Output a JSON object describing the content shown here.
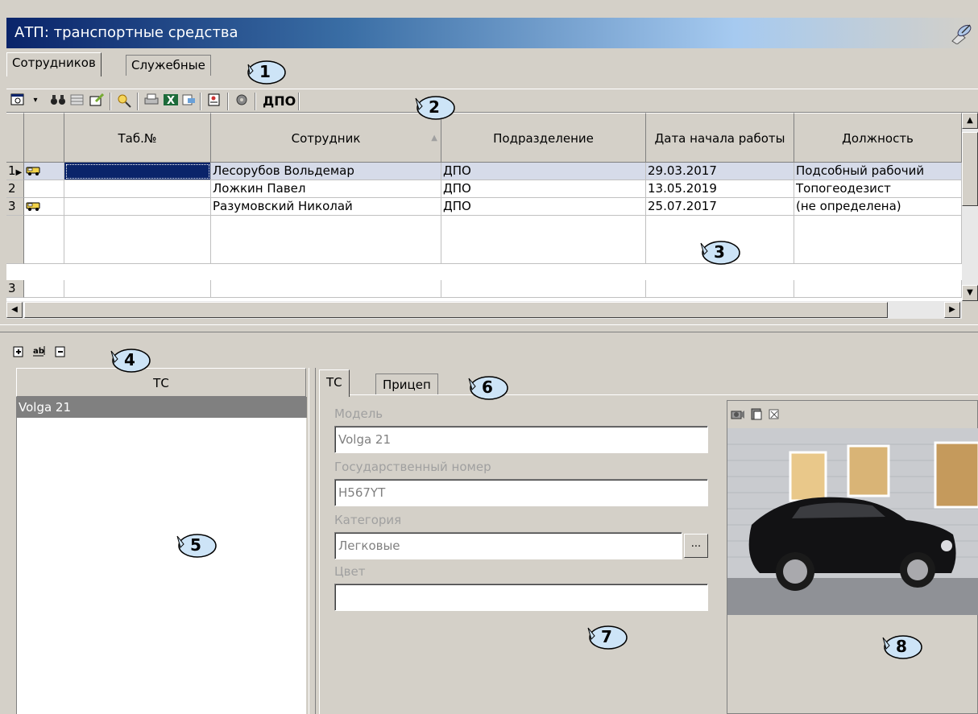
{
  "window": {
    "title": "АТП: транспортные средства"
  },
  "tabs": [
    "Сотрудников",
    "Служебные"
  ],
  "toolbar": {
    "filter_label": "ДПО"
  },
  "grid": {
    "columns": [
      "Таб.№",
      "Сотрудник",
      "Подразделение",
      "Дата начала работы",
      "Должность"
    ],
    "rows": [
      {
        "num": "1",
        "has_vehicle": true,
        "tab_no": "",
        "employee": "Лесорубов Вольдемар",
        "dept": "ДПО",
        "start": "29.03.2017",
        "position": "Подсобный рабочий"
      },
      {
        "num": "2",
        "has_vehicle": false,
        "tab_no": "",
        "employee": "Ложкин Павел",
        "dept": "ДПО",
        "start": "13.05.2019",
        "position": "Топогеодезист"
      },
      {
        "num": "3",
        "has_vehicle": true,
        "tab_no": "",
        "employee": "Разумовский Николай",
        "dept": "ДПО",
        "start": "25.07.2017",
        "position": "(не определена)"
      }
    ],
    "footer_count": "3"
  },
  "vehicles": {
    "header": "ТС",
    "items": [
      "Volga 21"
    ]
  },
  "details": {
    "tabs": [
      "ТС",
      "Прицеп"
    ],
    "model_label": "Модель",
    "model_value": "Volga 21",
    "plate_label": "Государственный номер",
    "plate_value": "Н567YT",
    "category_label": "Категория",
    "category_value": "Легковые",
    "category_button": "...",
    "color_label": "Цвет",
    "color_value": ""
  },
  "callouts": [
    "1",
    "2",
    "3",
    "4",
    "5",
    "6",
    "7",
    "8"
  ],
  "colors": {
    "title_start": "#0a246a",
    "title_end": "#a6caf0",
    "callout_fill": "#cde4f7",
    "selection": "#0a246a",
    "row_highlight": "#d6dbe9"
  }
}
